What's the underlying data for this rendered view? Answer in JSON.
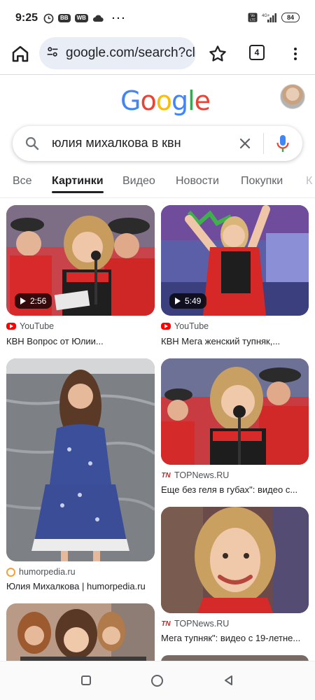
{
  "status_bar": {
    "time": "9:25",
    "badges": [
      "BB",
      "WB"
    ],
    "more": "···",
    "network": "4G+",
    "battery": "84"
  },
  "toolbar": {
    "url": "google.com/search?cl",
    "tab_count": "4"
  },
  "header": {
    "logo_letters": [
      {
        "char": "G",
        "color": "#4285F4"
      },
      {
        "char": "o",
        "color": "#EA4335"
      },
      {
        "char": "o",
        "color": "#FBBC05"
      },
      {
        "char": "g",
        "color": "#4285F4"
      },
      {
        "char": "l",
        "color": "#34A853"
      },
      {
        "char": "e",
        "color": "#EA4335"
      }
    ]
  },
  "search": {
    "query": "юлия михалкова в квн"
  },
  "tabs": [
    {
      "label": "Все",
      "active": false
    },
    {
      "label": "Картинки",
      "active": true
    },
    {
      "label": "Видео",
      "active": false
    },
    {
      "label": "Новости",
      "active": false
    },
    {
      "label": "Покупки",
      "active": false
    },
    {
      "label": "К",
      "active": false
    }
  ],
  "results": [
    {
      "source": "YouTube",
      "favicon": "youtube-icon",
      "title": "КВН Вопрос от Юлии...",
      "duration": "2:56"
    },
    {
      "source": "YouTube",
      "favicon": "youtube-icon",
      "title": "КВН Мега женский тупняк,...",
      "duration": "5:49"
    },
    {
      "source": "humorpedia.ru",
      "favicon": "humorpedia-icon",
      "title": "Юлия Михалкова | humorpedia.ru",
      "duration": null
    },
    {
      "source": "TOPNews.RU",
      "favicon": "topnews-icon",
      "title": "Еще без геля в губах\": видео с...",
      "duration": null
    },
    {
      "source": "TOPNews.RU",
      "favicon": "topnews-icon",
      "title": "Мега тупняк\": видео с 19-летне...",
      "duration": null
    }
  ],
  "colors": {
    "accent": "#1a73e8",
    "pill_bg": "#e9eef6",
    "youtube_red": "#ff0000",
    "topnews_red": "#c62828",
    "humorpedia_orange": "#f2a33a"
  }
}
